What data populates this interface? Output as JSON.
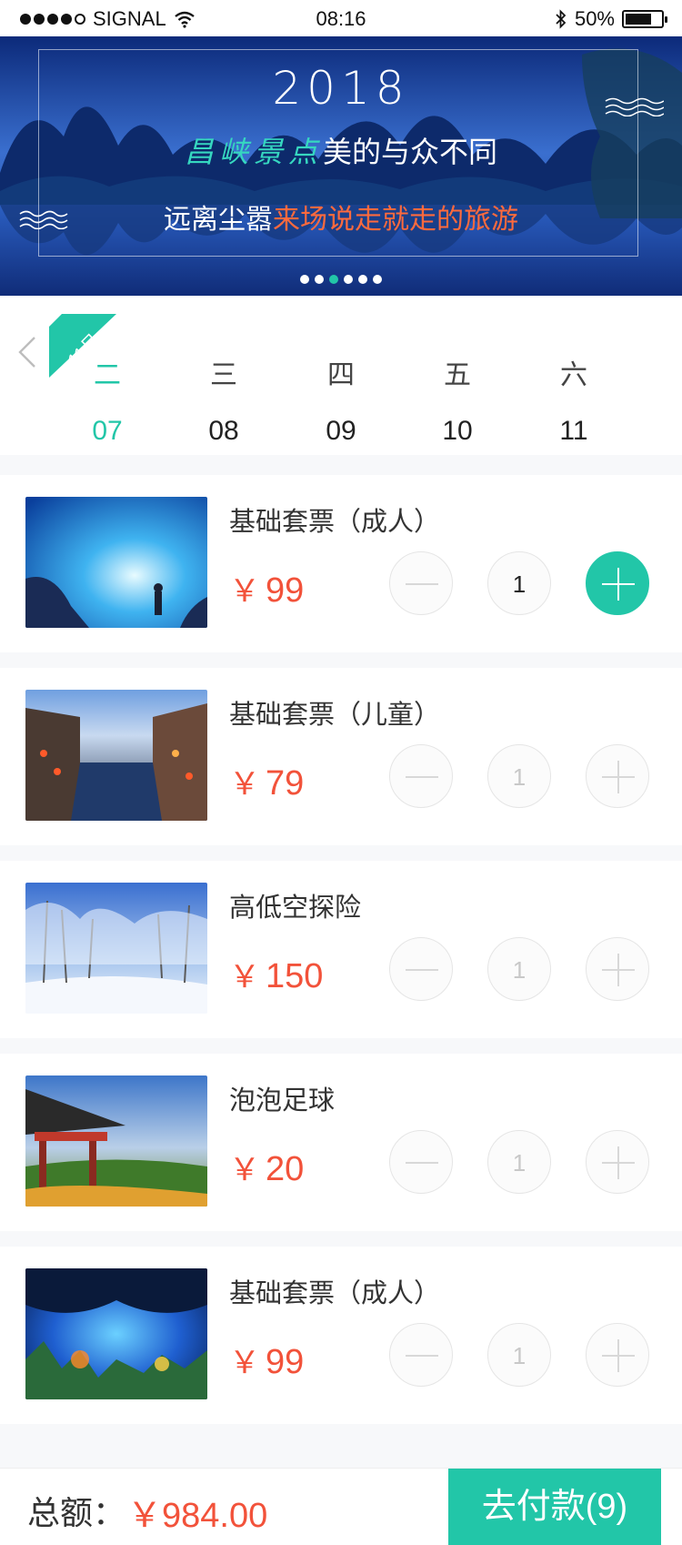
{
  "status_bar": {
    "carrier": "SIGNAL",
    "time": "08:16",
    "battery": "50%",
    "battery_level": 0.5
  },
  "banner": {
    "year": "2018",
    "title_accent": "昌峡景点",
    "title_rest": "美的与众不同",
    "subtitle_plain": "远离尘嚣",
    "subtitle_highlight": "来场说走就走的旅游",
    "pager_count": 6,
    "pager_active": 2
  },
  "date_picker": {
    "month": "11月",
    "days": [
      {
        "weekday": "二",
        "date": "07",
        "active": true
      },
      {
        "weekday": "三",
        "date": "08",
        "active": false
      },
      {
        "weekday": "四",
        "date": "09",
        "active": false
      },
      {
        "weekday": "五",
        "date": "10",
        "active": false
      },
      {
        "weekday": "六",
        "date": "11",
        "active": false
      }
    ]
  },
  "tickets": [
    {
      "name": "基础套票（成人）",
      "currency": "￥",
      "price": "99",
      "qty": "1",
      "active": true,
      "thumb": "ice-cave"
    },
    {
      "name": "基础套票（儿童）",
      "currency": "￥",
      "price": "79",
      "qty": "1",
      "active": false,
      "thumb": "water-town"
    },
    {
      "name": "高低空探险",
      "currency": "￥",
      "price": "150",
      "qty": "1",
      "active": false,
      "thumb": "snow-forest"
    },
    {
      "name": "泡泡足球",
      "currency": "￥",
      "price": "20",
      "qty": "1",
      "active": false,
      "thumb": "pavilion"
    },
    {
      "name": "基础套票（成人）",
      "currency": "￥",
      "price": "99",
      "qty": "1",
      "active": false,
      "thumb": "karst-cave"
    }
  ],
  "footer": {
    "total_label": "总额：",
    "total_value": "￥984.00",
    "pay_button": "去付款(9)"
  },
  "colors": {
    "accent": "#22c6a8",
    "price": "#f2523a"
  }
}
